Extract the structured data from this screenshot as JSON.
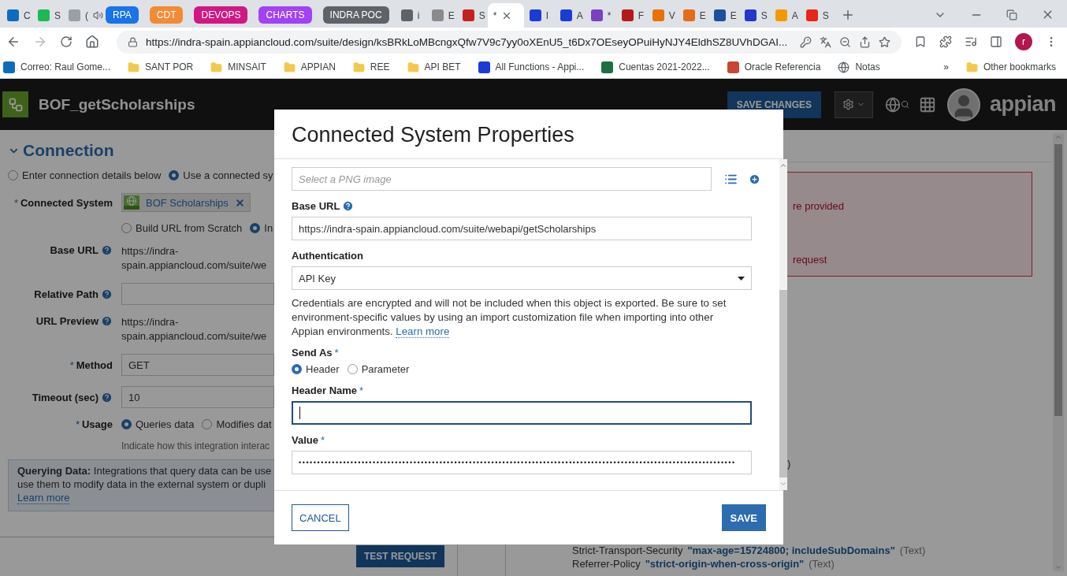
{
  "browser": {
    "tabs": [
      {
        "kind": "tab",
        "title": "C",
        "color": "#0f6cbd",
        "selected": false,
        "audio": false
      },
      {
        "kind": "tab",
        "title": "S",
        "color": "#1db954",
        "selected": false,
        "audio": false
      },
      {
        "kind": "tab",
        "title": "(",
        "color": "#9aa0a6",
        "selected": false,
        "audio": true
      },
      {
        "kind": "group",
        "label": "RPA",
        "color": "#1a73e8"
      },
      {
        "kind": "group",
        "label": "CDT",
        "color": "#f28b35"
      },
      {
        "kind": "group",
        "label": "DEVOPS",
        "color": "#d01884"
      },
      {
        "kind": "group",
        "label": "CHARTS",
        "color": "#a142f4"
      },
      {
        "kind": "group",
        "label": "INDRA POC",
        "color": "#5f6368"
      },
      {
        "kind": "tab",
        "title": "i",
        "color": "#5f6368",
        "selected": false,
        "audio": false
      },
      {
        "kind": "tab",
        "title": "E",
        "color": "#8a8a8a",
        "selected": false,
        "audio": false
      },
      {
        "kind": "tab",
        "title": "S",
        "color": "#c5221f",
        "selected": false,
        "audio": false
      },
      {
        "kind": "tab",
        "title": "*",
        "selected": true,
        "audio": false
      },
      {
        "kind": "tab",
        "title": "I",
        "color": "#1a3bd6",
        "selected": false,
        "audio": false
      },
      {
        "kind": "tab",
        "title": "A",
        "color": "#1a3bd6",
        "selected": false,
        "audio": false
      },
      {
        "kind": "tab",
        "title": "*",
        "color": "#7b3fc4",
        "selected": false,
        "audio": false
      },
      {
        "kind": "tab",
        "title": "F",
        "color": "#b31b1b",
        "selected": false,
        "audio": false
      },
      {
        "kind": "tab",
        "title": "V",
        "color": "#e8710a",
        "selected": false,
        "audio": false
      },
      {
        "kind": "tab",
        "title": "E",
        "color": "#e36c1a",
        "selected": false,
        "audio": false
      },
      {
        "kind": "tab",
        "title": "E",
        "color": "#1d4f9c",
        "selected": false,
        "audio": false
      },
      {
        "kind": "tab",
        "title": "S",
        "color": "#2437c9",
        "selected": false,
        "audio": false
      },
      {
        "kind": "tab",
        "title": "A",
        "color": "#f29900",
        "selected": false,
        "audio": false
      },
      {
        "kind": "tab",
        "title": "S",
        "color": "#e8241b",
        "selected": false,
        "audio": false
      }
    ],
    "url": "https://indra-spain.appiancloud.com/suite/design/ksBRkLoMBcngxQfw7V9c7yy0oXEnU5_t6Dx7OEseyOPuiHyNJY4EldhSZ8UVhDGAI...",
    "profile": "r",
    "bookmarks": [
      {
        "kind": "site",
        "label": "Correo: Raul Gome...",
        "color": "#0f6cbd"
      },
      {
        "kind": "folder",
        "label": "SANT POR"
      },
      {
        "kind": "folder",
        "label": "MINSAIT"
      },
      {
        "kind": "folder",
        "label": "APPIAN"
      },
      {
        "kind": "folder",
        "label": "REE"
      },
      {
        "kind": "folder",
        "label": "API BET"
      },
      {
        "kind": "site",
        "label": "All Functions - Appi...",
        "color": "#1a3bd6"
      },
      {
        "kind": "site",
        "label": "Cuentas 2021-2022...",
        "color": "#1d6f42"
      },
      {
        "kind": "site",
        "label": "Oracle Referencia",
        "color": "#c74634"
      },
      {
        "kind": "globe",
        "label": "Notas"
      }
    ],
    "bookmarks_overflow": "»",
    "other_bookmarks": "Other bookmarks"
  },
  "editor": {
    "title": "BOF_getScholarships",
    "save_button": "SAVE CHANGES",
    "logo_text": "appian",
    "connection": {
      "title": "Connection",
      "expanded": true,
      "mode_options": [
        {
          "label": "Enter connection details below",
          "selected": false
        },
        {
          "label": "Use a connected sy",
          "selected": true
        }
      ],
      "fields": [
        {
          "kind": "chip",
          "label": "Connected System",
          "marker": "*",
          "help": false,
          "value": "BOF Scholarships"
        },
        {
          "kind": "radios",
          "options": [
            {
              "label": "Build URL from Scratch",
              "selected": false
            },
            {
              "label": "In",
              "selected": true
            }
          ]
        },
        {
          "kind": "text",
          "label": "Base URL",
          "help": true,
          "value": "https://indra-spain.appiancloud.com/suite/we"
        },
        {
          "kind": "input",
          "label": "Relative Path",
          "help": true
        },
        {
          "kind": "text",
          "label": "URL Preview",
          "help": true,
          "value": "https://indra-spain.appiancloud.com/suite/we"
        },
        {
          "kind": "input",
          "label": "Method",
          "marker": "*",
          "help": false,
          "value": "GET"
        },
        {
          "kind": "input",
          "label": "Timeout (sec)",
          "help": true,
          "value": "10"
        },
        {
          "kind": "radios",
          "label": "Usage",
          "marker": "*",
          "help": false,
          "options": [
            {
              "label": "Queries data",
              "selected": true
            },
            {
              "label": "Modifies dat",
              "selected": false
            }
          ]
        },
        {
          "kind": "hint",
          "value": "Indicate how this integration interac"
        }
      ],
      "info": {
        "lines": [
          "**Querying Data:** Integrations that query data can be use",
          "use them to modify data in the external system or dupli"
        ],
        "link": "Learn more"
      }
    },
    "test_button": "TEST REQUEST",
    "result": {
      "error_lines": [
        "re provided",
        "request"
      ],
      "fragment": ")",
      "headers": [
        {
          "name": "Strict-Transport-Security",
          "value": "\"max-age=15724800; includeSubDomains\"",
          "type": "(Text)"
        },
        {
          "name": "Referrer-Policy",
          "value": "\"strict-origin-when-cross-origin\"",
          "type": "(Text)"
        }
      ]
    }
  },
  "dialog": {
    "title": "Connected System Properties",
    "image_field": {
      "placeholder": "Select a PNG image"
    },
    "base_url": {
      "label": "Base URL",
      "help": true,
      "value": "https://indra-spain.appiancloud.com/suite/webapi/getScholarships"
    },
    "authentication": {
      "label": "Authentication",
      "value": "API Key"
    },
    "note": {
      "text": "Credentials are encrypted and will not be included when this object is exported. Be sure to set environment-specific values by using an import customization file when importing into other Appian environments.",
      "link": "Learn more"
    },
    "send_as": {
      "label": "Send As",
      "marker": "*",
      "options": [
        {
          "label": "Header",
          "selected": true
        },
        {
          "label": "Parameter",
          "selected": false
        }
      ]
    },
    "header_name": {
      "label": "Header Name",
      "marker": "*",
      "focused": true
    },
    "value": {
      "label": "Value",
      "marker": "*",
      "masked": "••••••••••••••••••••••••••••••••••••••••••••••••••••••••••••••••••••••••••••••••••••••••••••••••••••••••••••••••••••••"
    },
    "cancel_button": "CANCEL",
    "save_button": "SAVE"
  }
}
